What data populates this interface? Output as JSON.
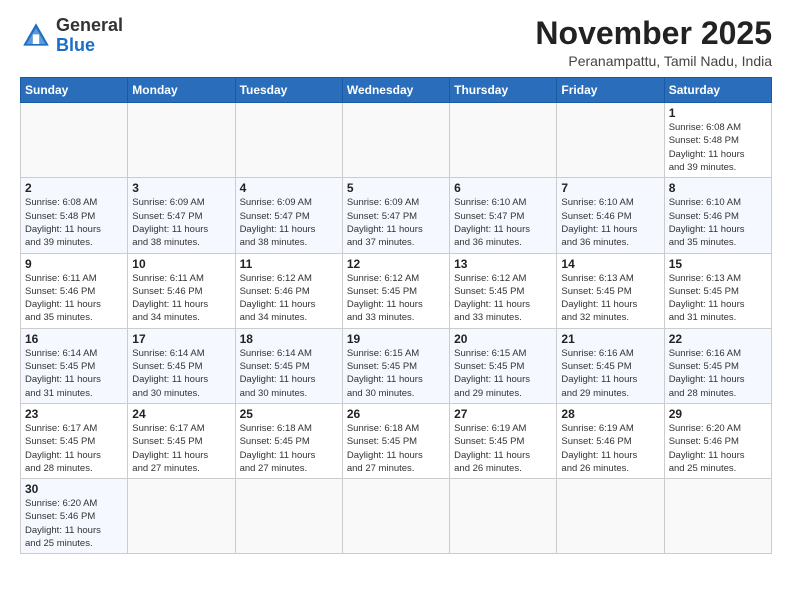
{
  "header": {
    "logo_general": "General",
    "logo_blue": "Blue",
    "month_title": "November 2025",
    "subtitle": "Peranampattu, Tamil Nadu, India"
  },
  "weekdays": [
    "Sunday",
    "Monday",
    "Tuesday",
    "Wednesday",
    "Thursday",
    "Friday",
    "Saturday"
  ],
  "weeks": [
    [
      {
        "day": "",
        "info": ""
      },
      {
        "day": "",
        "info": ""
      },
      {
        "day": "",
        "info": ""
      },
      {
        "day": "",
        "info": ""
      },
      {
        "day": "",
        "info": ""
      },
      {
        "day": "",
        "info": ""
      },
      {
        "day": "1",
        "info": "Sunrise: 6:08 AM\nSunset: 5:48 PM\nDaylight: 11 hours\nand 39 minutes."
      }
    ],
    [
      {
        "day": "2",
        "info": "Sunrise: 6:08 AM\nSunset: 5:48 PM\nDaylight: 11 hours\nand 39 minutes."
      },
      {
        "day": "3",
        "info": "Sunrise: 6:09 AM\nSunset: 5:47 PM\nDaylight: 11 hours\nand 38 minutes."
      },
      {
        "day": "4",
        "info": "Sunrise: 6:09 AM\nSunset: 5:47 PM\nDaylight: 11 hours\nand 38 minutes."
      },
      {
        "day": "5",
        "info": "Sunrise: 6:09 AM\nSunset: 5:47 PM\nDaylight: 11 hours\nand 37 minutes."
      },
      {
        "day": "6",
        "info": "Sunrise: 6:10 AM\nSunset: 5:47 PM\nDaylight: 11 hours\nand 36 minutes."
      },
      {
        "day": "7",
        "info": "Sunrise: 6:10 AM\nSunset: 5:46 PM\nDaylight: 11 hours\nand 36 minutes."
      },
      {
        "day": "8",
        "info": "Sunrise: 6:10 AM\nSunset: 5:46 PM\nDaylight: 11 hours\nand 35 minutes."
      }
    ],
    [
      {
        "day": "9",
        "info": "Sunrise: 6:11 AM\nSunset: 5:46 PM\nDaylight: 11 hours\nand 35 minutes."
      },
      {
        "day": "10",
        "info": "Sunrise: 6:11 AM\nSunset: 5:46 PM\nDaylight: 11 hours\nand 34 minutes."
      },
      {
        "day": "11",
        "info": "Sunrise: 6:12 AM\nSunset: 5:46 PM\nDaylight: 11 hours\nand 34 minutes."
      },
      {
        "day": "12",
        "info": "Sunrise: 6:12 AM\nSunset: 5:45 PM\nDaylight: 11 hours\nand 33 minutes."
      },
      {
        "day": "13",
        "info": "Sunrise: 6:12 AM\nSunset: 5:45 PM\nDaylight: 11 hours\nand 33 minutes."
      },
      {
        "day": "14",
        "info": "Sunrise: 6:13 AM\nSunset: 5:45 PM\nDaylight: 11 hours\nand 32 minutes."
      },
      {
        "day": "15",
        "info": "Sunrise: 6:13 AM\nSunset: 5:45 PM\nDaylight: 11 hours\nand 31 minutes."
      }
    ],
    [
      {
        "day": "16",
        "info": "Sunrise: 6:14 AM\nSunset: 5:45 PM\nDaylight: 11 hours\nand 31 minutes."
      },
      {
        "day": "17",
        "info": "Sunrise: 6:14 AM\nSunset: 5:45 PM\nDaylight: 11 hours\nand 30 minutes."
      },
      {
        "day": "18",
        "info": "Sunrise: 6:14 AM\nSunset: 5:45 PM\nDaylight: 11 hours\nand 30 minutes."
      },
      {
        "day": "19",
        "info": "Sunrise: 6:15 AM\nSunset: 5:45 PM\nDaylight: 11 hours\nand 30 minutes."
      },
      {
        "day": "20",
        "info": "Sunrise: 6:15 AM\nSunset: 5:45 PM\nDaylight: 11 hours\nand 29 minutes."
      },
      {
        "day": "21",
        "info": "Sunrise: 6:16 AM\nSunset: 5:45 PM\nDaylight: 11 hours\nand 29 minutes."
      },
      {
        "day": "22",
        "info": "Sunrise: 6:16 AM\nSunset: 5:45 PM\nDaylight: 11 hours\nand 28 minutes."
      }
    ],
    [
      {
        "day": "23",
        "info": "Sunrise: 6:17 AM\nSunset: 5:45 PM\nDaylight: 11 hours\nand 28 minutes."
      },
      {
        "day": "24",
        "info": "Sunrise: 6:17 AM\nSunset: 5:45 PM\nDaylight: 11 hours\nand 27 minutes."
      },
      {
        "day": "25",
        "info": "Sunrise: 6:18 AM\nSunset: 5:45 PM\nDaylight: 11 hours\nand 27 minutes."
      },
      {
        "day": "26",
        "info": "Sunrise: 6:18 AM\nSunset: 5:45 PM\nDaylight: 11 hours\nand 27 minutes."
      },
      {
        "day": "27",
        "info": "Sunrise: 6:19 AM\nSunset: 5:45 PM\nDaylight: 11 hours\nand 26 minutes."
      },
      {
        "day": "28",
        "info": "Sunrise: 6:19 AM\nSunset: 5:46 PM\nDaylight: 11 hours\nand 26 minutes."
      },
      {
        "day": "29",
        "info": "Sunrise: 6:20 AM\nSunset: 5:46 PM\nDaylight: 11 hours\nand 25 minutes."
      }
    ],
    [
      {
        "day": "30",
        "info": "Sunrise: 6:20 AM\nSunset: 5:46 PM\nDaylight: 11 hours\nand 25 minutes."
      },
      {
        "day": "",
        "info": ""
      },
      {
        "day": "",
        "info": ""
      },
      {
        "day": "",
        "info": ""
      },
      {
        "day": "",
        "info": ""
      },
      {
        "day": "",
        "info": ""
      },
      {
        "day": "",
        "info": ""
      }
    ]
  ]
}
